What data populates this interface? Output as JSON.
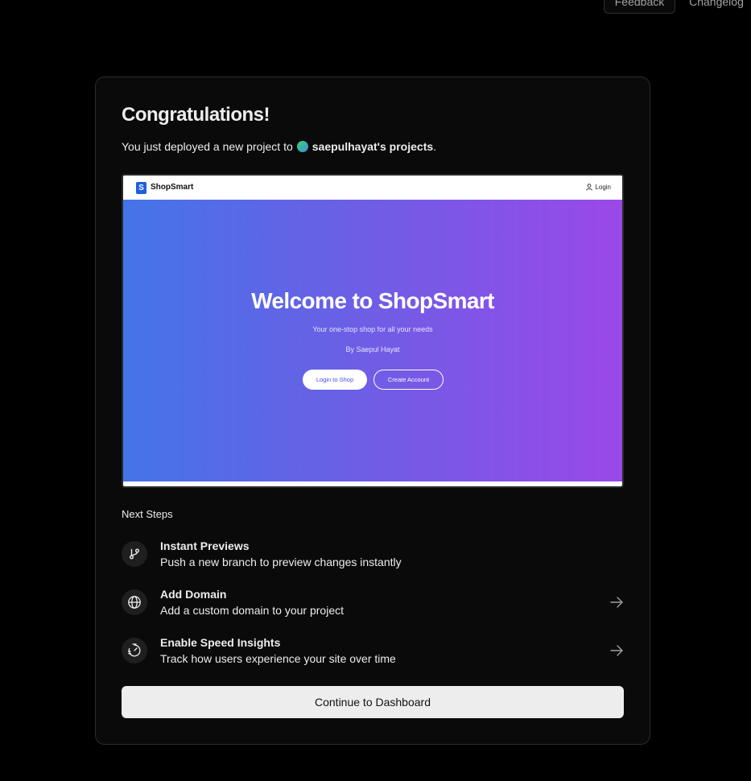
{
  "topbar": {
    "feedback_label": "Feedback",
    "changelog_label": "Changelog"
  },
  "card": {
    "title": "Congratulations!",
    "subtitle_prefix": "You just deployed a new project to",
    "team_name": "saepulhayat's projects",
    "subtitle_suffix": "."
  },
  "preview": {
    "brand": "ShopSmart",
    "logo_glyph": "S",
    "nav_login": "Login",
    "hero_title": "Welcome to ShopSmart",
    "hero_subtitle": "Your one-stop shop for all your needs",
    "hero_author": "By Saepul Hayat",
    "primary_button": "Login to Shop",
    "secondary_button": "Create Account"
  },
  "next_steps": {
    "heading": "Next Steps",
    "items": [
      {
        "title": "Instant Previews",
        "description": "Push a new branch to preview changes instantly",
        "icon": "git-branch-icon",
        "has_arrow": false
      },
      {
        "title": "Add Domain",
        "description": "Add a custom domain to your project",
        "icon": "globe-icon",
        "has_arrow": true
      },
      {
        "title": "Enable Speed Insights",
        "description": "Track how users experience your site over time",
        "icon": "speed-gauge-icon",
        "has_arrow": true
      }
    ]
  },
  "continue_label": "Continue to Dashboard",
  "colors": {
    "background": "#000000",
    "card": "#0a0a0a",
    "button": "#ededed",
    "hero_gradient_start": "#4474e8",
    "hero_gradient_end": "#9a48e8"
  }
}
